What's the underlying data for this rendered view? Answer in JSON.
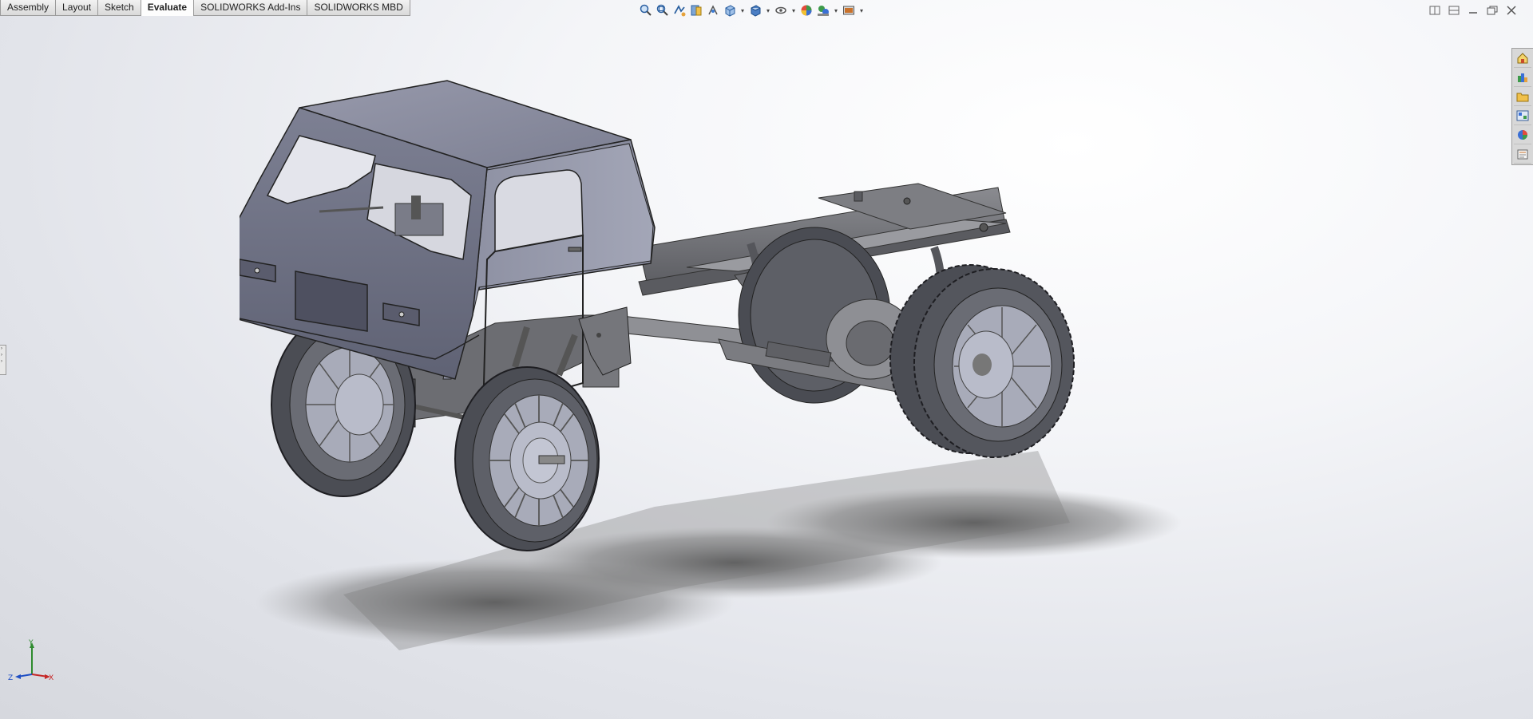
{
  "command_tabs": [
    {
      "label": "Assembly",
      "active": false
    },
    {
      "label": "Layout",
      "active": false
    },
    {
      "label": "Sketch",
      "active": false
    },
    {
      "label": "Evaluate",
      "active": true
    },
    {
      "label": "SOLIDWORKS Add-Ins",
      "active": false
    },
    {
      "label": "SOLIDWORKS MBD",
      "active": false
    }
  ],
  "view_toolbar": [
    "zoom-to-fit-icon",
    "zoom-to-area-icon",
    "previous-view-icon",
    "section-view-icon",
    "dynamic-annotation-icon",
    "view-orientation-icon",
    "display-style-icon",
    "hide-show-items-icon",
    "edit-appearance-icon",
    "apply-scene-icon",
    "view-settings-icon"
  ],
  "task_pane": [
    "solidworks-resources-icon",
    "design-library-icon",
    "file-explorer-icon",
    "view-palette-icon",
    "appearances-icon",
    "custom-properties-icon"
  ],
  "triad": {
    "x": "X",
    "y": "Y",
    "z": "Z"
  },
  "colors": {
    "body": "#8a8d9e",
    "frame": "#6f7076",
    "tire": "#5a5c63",
    "rim": "#a7aab8"
  }
}
